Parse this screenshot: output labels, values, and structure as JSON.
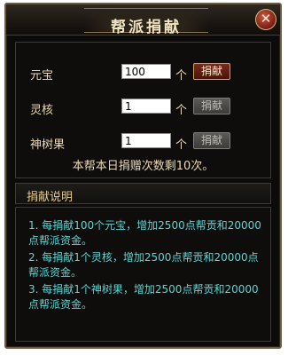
{
  "window": {
    "title": "帮派捐献",
    "close_label": "✕"
  },
  "rows": [
    {
      "label": "元宝",
      "value": "100",
      "unit": "个",
      "button": "捐献",
      "enabled": true
    },
    {
      "label": "灵核",
      "value": "1",
      "unit": "个",
      "button": "捐献",
      "enabled": false
    },
    {
      "label": "神树果",
      "value": "1",
      "unit": "个",
      "button": "捐献",
      "enabled": false
    }
  ],
  "remaining_text": "本帮本日捐赠次数剩10次。",
  "description": {
    "title": "捐献说明",
    "items": [
      "1.  每捐献100个元宝，增加2500点帮贡和20000点帮派资金。",
      "2.  每捐献1个灵核，增加2500点帮贡和20000点帮派资金。",
      "3.  每捐献1个神树果，增加2500点帮贡和20000点帮派资金。"
    ]
  },
  "colors": {
    "accent": "#e3c98d",
    "description_text": "#5fd3d0",
    "panel_bg": "#0c0b0a"
  }
}
